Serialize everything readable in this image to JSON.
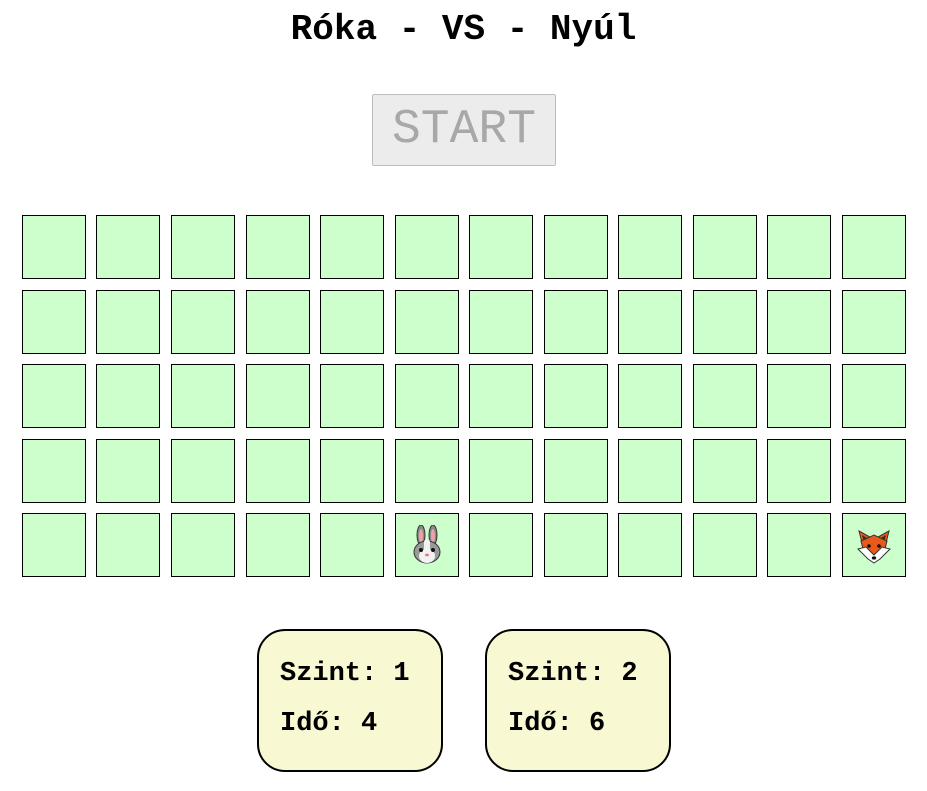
{
  "title": "Róka - VS - Nyúl",
  "start_label": "START",
  "board": {
    "rows": 5,
    "cols": 12,
    "cell_color": "#ccffcc",
    "pieces": [
      {
        "name": "rabbit",
        "icon": "rabbit-icon",
        "row": 4,
        "col": 5
      },
      {
        "name": "fox",
        "icon": "fox-icon",
        "row": 4,
        "col": 11
      }
    ]
  },
  "panels": [
    {
      "level_label": "Szint:",
      "level": "1",
      "time_label": "Idő:",
      "time": "4"
    },
    {
      "level_label": "Szint:",
      "level": "2",
      "time_label": "Idő:",
      "time": "6"
    }
  ],
  "colors": {
    "cell": "#ccffcc",
    "panel": "#f8f8d2",
    "start_bg": "#ececec",
    "start_text": "#a8a8a8"
  }
}
